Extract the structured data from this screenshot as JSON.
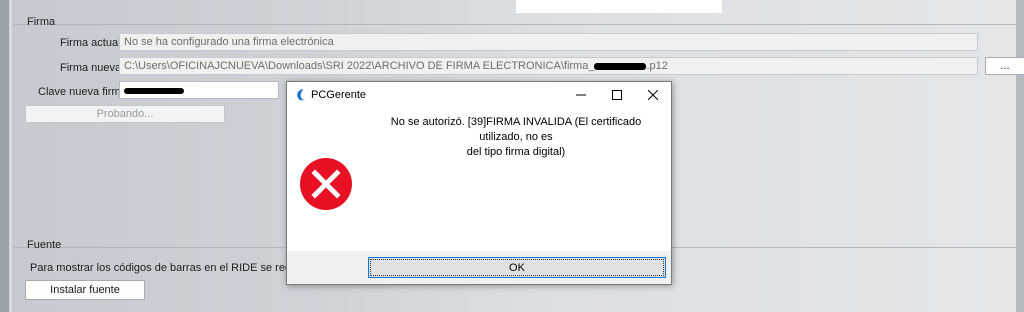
{
  "firma": {
    "legend": "Firma",
    "actual_label": "Firma actual",
    "actual_value": "No se ha configurado una firma electrónica",
    "nueva_label": "Firma nueva",
    "nueva_path_prefix": "C:\\Users\\OFICINAJCNUEVA\\Downloads\\SRI 2022\\ARCHIVO DE FIRMA ELECTRONICA\\firma_",
    "nueva_path_suffix": ".p12",
    "browse_label": "...",
    "clave_label": "Clave nueva firma",
    "probando_label": "Probando..."
  },
  "fuente": {
    "legend": "Fuente",
    "info_text": "Para mostrar los códigos de barras en el RIDE se requiere la f",
    "install_label": "Instalar fuente"
  },
  "dialog": {
    "title": "PCGerente",
    "message_line1": "No se autorizó. [39]FIRMA INVALIDA (El certificado utilizado, no es",
    "message_line2": "del tipo firma digital)",
    "ok_label": "OK",
    "icon": "error-icon",
    "error_color": "#e81123"
  }
}
